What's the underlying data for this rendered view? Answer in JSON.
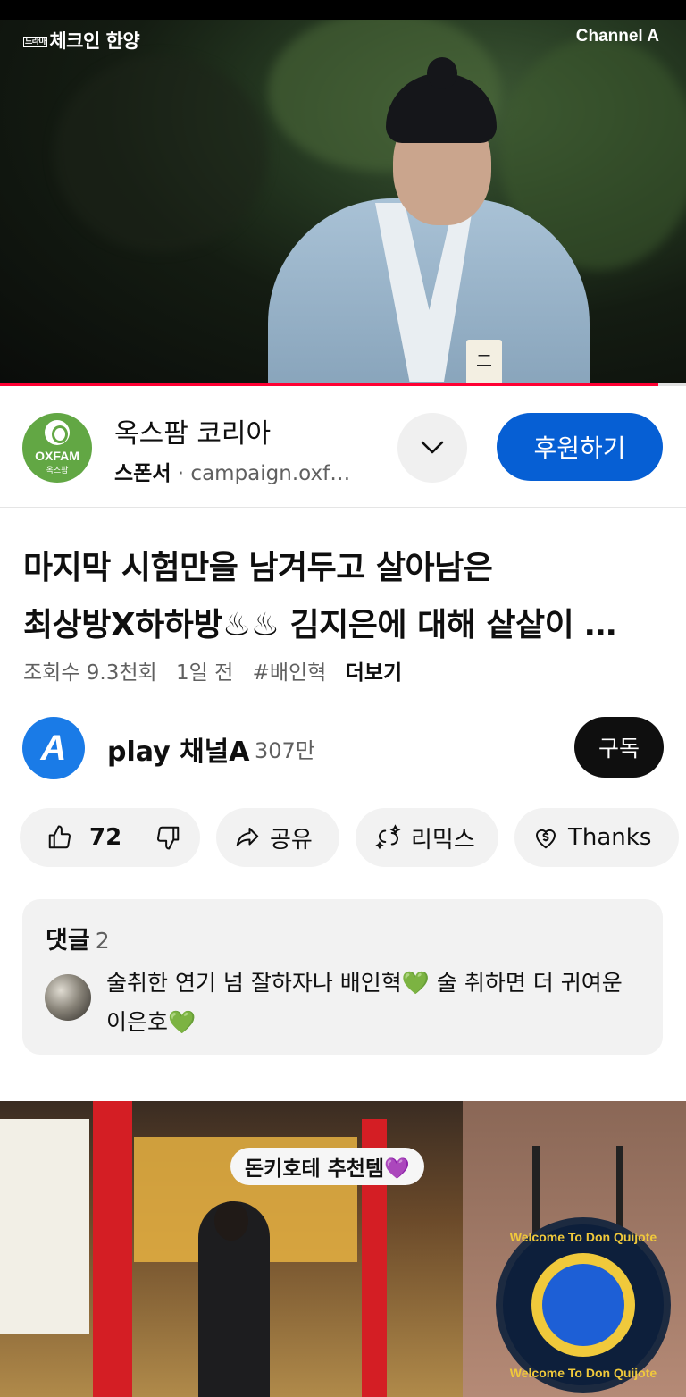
{
  "player": {
    "show_title": "체크인 한양",
    "show_title_mini": "드라마",
    "channel_logo": "Channel A",
    "nametag": "二",
    "progress": 0.96,
    "progress_color": "#ff0033"
  },
  "ad": {
    "logo_word": "OXFAM",
    "logo_sub": "옥스팜",
    "title": "옥스팜 코리아",
    "sponsor_label": "스폰서",
    "separator": "·",
    "url": "campaign.oxf…",
    "expand_icon": "chevron-down-icon",
    "cta_label": "후원하기",
    "cta_color": "#065fd4"
  },
  "video": {
    "title_line1": "마지막 시험만을 남겨두고 살아남은",
    "title_line2": "최상방X하하방♨♨ 김지은에 대해 샅샅이 …",
    "views": "조회수 9.3천회",
    "age": "1일 전",
    "hashtag": "#배인혁",
    "more": "더보기"
  },
  "channel": {
    "avatar_letter": "A",
    "name": "play 채널A",
    "subscribers": "307만",
    "subscribe_label": "구독"
  },
  "actions": {
    "like_icon": "thumbs-up-icon",
    "like_count": "72",
    "dislike_icon": "thumbs-down-icon",
    "share_icon": "share-arrow-icon",
    "share_label": "공유",
    "remix_icon": "remix-icon",
    "remix_label": "리믹스",
    "thanks_icon": "heart-dollar-icon",
    "thanks_label": "Thanks"
  },
  "comments": {
    "header": "댓글",
    "count": "2",
    "top_comment_part1": "술취한 연기 넘 잘하자나 배인혁",
    "top_comment_part2": " 술 취하면 더 귀여운 이은호",
    "heart_emoji": "💚",
    "heart_color": "#19c25a"
  },
  "next_video": {
    "caption": "돈키호테 추천템💜",
    "sign_top": "Welcome To Don Quijote",
    "sign_bottom": "Welcome To Don Quijote"
  }
}
